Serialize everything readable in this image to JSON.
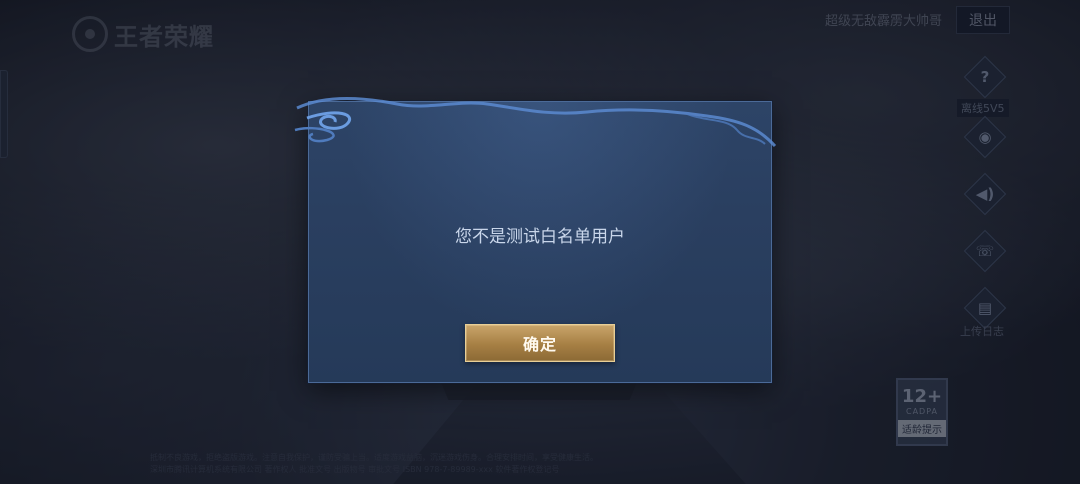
{
  "header": {
    "logo_text": "王者荣耀",
    "account_text": "超级无敌霹雳大帅哥",
    "logout_label": "退出"
  },
  "side_panel": {
    "help_label": "离线5V5",
    "announcement_label": "上传日志"
  },
  "age_rating": {
    "number": "12+",
    "org": "CADPA",
    "note": "适龄提示"
  },
  "footer": {
    "line1": "抵制不良游戏，拒绝盗版游戏。注意自我保护，谨防受骗上当。适度游戏益脑，沉迷游戏伤身。合理安排时间，享受健康生活。",
    "line2": "深圳市腾讯计算机系统有限公司 著作权人 批准文号 出版物号 审批文号 ISBN 978-7-89989-xxx 软件著作权登记号"
  },
  "dialog": {
    "message": "您不是测试白名单用户",
    "confirm_label": "确定"
  },
  "icons": {
    "help": "question-icon",
    "camera": "camera-icon",
    "sound": "speaker-icon",
    "chat": "chat-icon",
    "notice": "clipboard-icon"
  },
  "colors": {
    "dialog_bg": "#2a3f60",
    "dialog_border": "#4b6a98",
    "confirm_gold": "#b08a4c",
    "message_text": "#c9d6ea"
  }
}
